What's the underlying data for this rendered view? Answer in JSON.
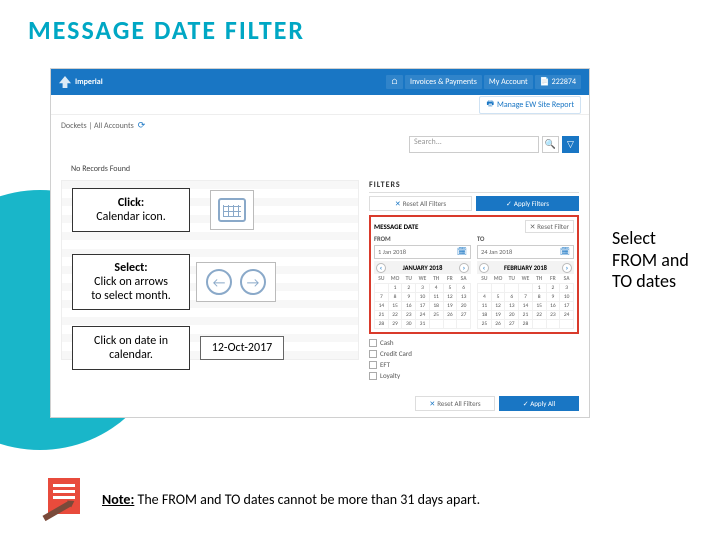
{
  "title": "MESSAGE DATE FILTER",
  "app": {
    "brand": "Imperial",
    "nav": {
      "home": "⌂",
      "invoices": "Invoices & Payments",
      "account": "My Account",
      "acct_no": "222874"
    },
    "subbar": "Manage EW Site Report",
    "crumbs": "Dockets | All Accounts",
    "search_placeholder": "Search...",
    "tab": "No Records Found"
  },
  "filters": {
    "header": "FILTERS",
    "reset": "Reset All Filters",
    "apply": "Apply Filters",
    "msg_header": "MESSAGE DATE",
    "reset_filter": "Reset Filter",
    "from_label": "FROM",
    "to_label": "TO",
    "from_value": "1 Jan 2018",
    "to_value": "24 Jan 2018",
    "month_from": "JANUARY 2018",
    "month_to": "FEBRUARY 2018",
    "dow": [
      "SU",
      "MO",
      "TU",
      "WE",
      "TH",
      "FR",
      "SA"
    ],
    "jan": [
      [
        "",
        "1",
        "2",
        "3",
        "4",
        "5",
        "6"
      ],
      [
        "7",
        "8",
        "9",
        "10",
        "11",
        "12",
        "13"
      ],
      [
        "14",
        "15",
        "16",
        "17",
        "18",
        "19",
        "20"
      ],
      [
        "21",
        "22",
        "23",
        "24",
        "25",
        "26",
        "27"
      ],
      [
        "28",
        "29",
        "30",
        "31",
        "",
        "",
        ""
      ]
    ],
    "feb": [
      [
        "",
        "",
        "",
        "",
        "1",
        "2",
        "3"
      ],
      [
        "4",
        "5",
        "6",
        "7",
        "8",
        "9",
        "10"
      ],
      [
        "11",
        "12",
        "13",
        "14",
        "15",
        "16",
        "17"
      ],
      [
        "18",
        "19",
        "20",
        "21",
        "22",
        "23",
        "24"
      ],
      [
        "25",
        "26",
        "27",
        "28",
        "",
        "",
        ""
      ]
    ],
    "paytypes": [
      "Cash",
      "Credit Card",
      "EFT",
      "Loyalty"
    ]
  },
  "instr": {
    "i1a": "Click:",
    "i1b": "Calendar icon.",
    "i2a": "Select:",
    "i2b": "Click on arrows",
    "i2c": "to select month.",
    "i3a": "Click on date in",
    "i3b": "calendar.",
    "date_chip": "12-Oct-2017"
  },
  "side_note": "Select FROM and TO dates",
  "footer": {
    "lead": "Note:",
    "text": " The FROM and TO dates cannot be more than 31 days apart."
  }
}
